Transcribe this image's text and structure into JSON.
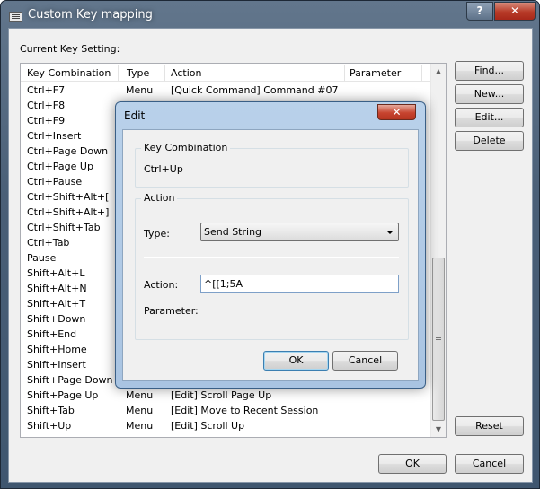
{
  "window": {
    "title": "Custom Key mapping",
    "help_label": "?",
    "close_label": "✕",
    "current_label": "Current Key Setting:"
  },
  "list": {
    "columns": [
      "Key Combination",
      "Type",
      "Action",
      "Parameter"
    ],
    "rows": [
      {
        "key": "Ctrl+F7",
        "type": "Menu",
        "action": "[Quick Command] Command #07"
      },
      {
        "key": "Ctrl+F8",
        "type": "",
        "action": ""
      },
      {
        "key": "Ctrl+F9",
        "type": "",
        "action": ""
      },
      {
        "key": "Ctrl+Insert",
        "type": "",
        "action": ""
      },
      {
        "key": "Ctrl+Page Down",
        "type": "",
        "action": ""
      },
      {
        "key": "Ctrl+Page Up",
        "type": "",
        "action": ""
      },
      {
        "key": "Ctrl+Pause",
        "type": "",
        "action": ""
      },
      {
        "key": "Ctrl+Shift+Alt+[",
        "type": "",
        "action": ""
      },
      {
        "key": "Ctrl+Shift+Alt+]",
        "type": "",
        "action": ""
      },
      {
        "key": "Ctrl+Shift+Tab",
        "type": "",
        "action": ""
      },
      {
        "key": "Ctrl+Tab",
        "type": "",
        "action": ""
      },
      {
        "key": "Pause",
        "type": "",
        "action": ""
      },
      {
        "key": "Shift+Alt+L",
        "type": "",
        "action": ""
      },
      {
        "key": "Shift+Alt+N",
        "type": "",
        "action": ""
      },
      {
        "key": "Shift+Alt+T",
        "type": "",
        "action": ""
      },
      {
        "key": "Shift+Down",
        "type": "",
        "action": ""
      },
      {
        "key": "Shift+End",
        "type": "",
        "action": ""
      },
      {
        "key": "Shift+Home",
        "type": "",
        "action": ""
      },
      {
        "key": "Shift+Insert",
        "type": "",
        "action": ""
      },
      {
        "key": "Shift+Page Down",
        "type": "",
        "action": ""
      },
      {
        "key": "Shift+Page Up",
        "type": "Menu",
        "action": "[Edit] Scroll Page Up"
      },
      {
        "key": "Shift+Tab",
        "type": "Menu",
        "action": "[Edit] Move to Recent Session"
      },
      {
        "key": "Shift+Up",
        "type": "Menu",
        "action": "[Edit] Scroll Up"
      }
    ]
  },
  "side_buttons": {
    "find": "Find...",
    "new": "New...",
    "edit": "Edit...",
    "delete": "Delete",
    "reset": "Reset"
  },
  "footer": {
    "ok": "OK",
    "cancel": "Cancel"
  },
  "edit_dialog": {
    "title": "Edit",
    "close_label": "✕",
    "key_group_label": "Key Combination",
    "key_value": "Ctrl+Up",
    "action_group_label": "Action",
    "type_label": "Type:",
    "type_value": "Send String",
    "action_label": "Action:",
    "action_value": "^[[1;5A",
    "parameter_label": "Parameter:",
    "ok": "OK",
    "cancel": "Cancel"
  }
}
